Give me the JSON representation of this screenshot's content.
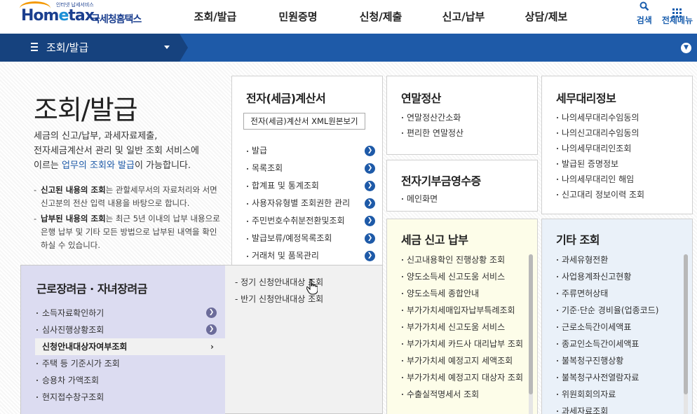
{
  "header": {
    "logo_main_pre": "Hom",
    "logo_main_e": "e",
    "logo_main_post": "tax.",
    "logo_sub": "국세청홈택스",
    "logo_tag": "인터넷 납세서비스",
    "gnb": [
      "조회/발급",
      "민원증명",
      "신청/제출",
      "신고/납부",
      "상담/제보"
    ],
    "search_label": "검색",
    "allmenu_label": "전체메뉴"
  },
  "location": {
    "current": "조회/발급"
  },
  "page": {
    "title": "조회/발급",
    "intro_1": "세금의 신고/납부, 과세자료제출,",
    "intro_2": "전자세금계산서 관리 및 일반 조회 서비스에",
    "intro_3a": "이르는 ",
    "intro_3b": "업무의 조회와 발급",
    "intro_3c": "이 가능합니다.",
    "notes": [
      {
        "bold": "신고된 내용의 조회",
        "text": "는 관할세무서의 자료처리와 서면신고분의 전산 입력 내용을 바탕으로 합니다."
      },
      {
        "bold": "납부된 내용의 조회",
        "text": "는 최근 5년 이내의 납부 내용으로 은행 납부 및 기타 모든 방법으로 납부된 내역을 확인하실 수 있습니다."
      }
    ]
  },
  "esign": {
    "title": "전자(세금)계산서",
    "xml_button": "전자(세금)계산서 XML원본보기",
    "items": [
      "발급",
      "목록조회",
      "합계표 및 통계조회",
      "사용자유형별 조회권한 관리",
      "주민번호수취분전환및조회",
      "발급보류/예정목록조회",
      "거래처 및 품목관리"
    ]
  },
  "year_end": {
    "title": "연말정산",
    "items": [
      "연말정산간소화",
      "편리한 연말정산"
    ]
  },
  "donation": {
    "title": "전자기부금영수증",
    "items": [
      "메인화면"
    ]
  },
  "agent": {
    "title": "세무대리정보",
    "items": [
      "나의세무대리수임동의",
      "나의신고대리수임동의",
      "나의세무대리인조회",
      "발급된 증명정보",
      "나의세무대리인 해임",
      "신고대리 정보이력 조회"
    ]
  },
  "report": {
    "title": "세금 신고 납부",
    "items": [
      "신고내용확인 진행상황 조회",
      "양도소득세 신고도움 서비스",
      "양도소득세 종합안내",
      "부가가치세매입자납부특례조회",
      "부가가치세 신고도움 서비스",
      "부가가치세 카드사 대리납부 조회",
      "부가가치세 예정고지 세액조회",
      "부가가치세 예정고지 대상자 조회",
      "수출실적명세서 조회"
    ]
  },
  "other": {
    "title": "기타 조회",
    "items": [
      "과세유형전환",
      "사업용계좌신고현황",
      "주류면허상태",
      "기준·단순 경비율(업종코드)",
      "근로소득간이세액표",
      "종교인소득간이세액표",
      "불복청구진행상황",
      "불복청구사전열람자료",
      "위원회회의자료",
      "과세자료조회"
    ]
  },
  "dropdown": {
    "title": "근로장려금 · 자녀장려금",
    "items": [
      {
        "label": "소득자료확인하기",
        "go": true
      },
      {
        "label": "심사진행상황조회",
        "go": true
      },
      {
        "label": "신청안내대상자여부조회",
        "active": true
      },
      {
        "label": "주택 등 기준시가 조회"
      },
      {
        "label": "승용차 가액조회"
      },
      {
        "label": "현지접수창구조회"
      }
    ],
    "sub_items": [
      "- 정기 신청안내대상 조회",
      "- 반기 신청안내대상 조회"
    ]
  },
  "colors": {
    "brand_blue": "#1e5aa8",
    "dark_blue": "#16427e",
    "dropdown_left": "#dcdcf1",
    "report_bg": "#fdfde9",
    "other_bg": "#eaf1f9"
  }
}
